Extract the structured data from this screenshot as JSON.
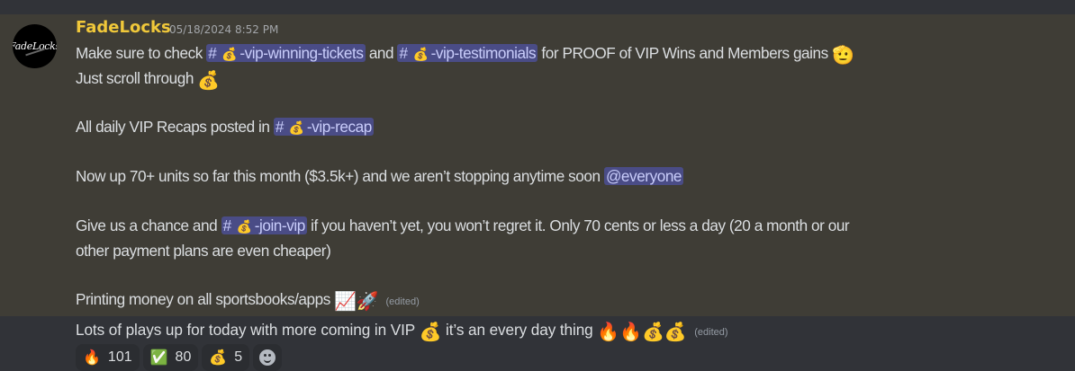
{
  "message": {
    "author": "FadeLocks",
    "avatar_text": "FadeLocks",
    "timestamp": "05/18/2024 8:52 PM",
    "line1_pre": "Make sure to check",
    "channel_winning": "-vip-winning-tickets",
    "line1_and": "and",
    "channel_testimonials": "-vip-testimonials",
    "line1_post": "for PROOF of VIP Wins and Members gains",
    "line2": "Just scroll through",
    "recap_pre": "All daily VIP Recaps posted in",
    "channel_recap": "-vip-recap",
    "units_text": "Now up 70+ units so far this month ($3.5k+) and we aren’t stopping anytime soon",
    "mention_everyone": "@everyone",
    "chance_pre": "Give us a chance and",
    "channel_join": "-join-vip",
    "chance_post": "if you haven’t yet, you won’t regret it. Only 70 cents or less a day (20 a month or our",
    "chance_line2": "other payment plans are even cheaper)",
    "printing": "Printing money on all sportsbooks/apps",
    "edited1": "(edited)",
    "plays_pre": "Lots of plays up for today with more coming in VIP",
    "plays_post": "it’s an every day thing",
    "edited2": "(edited)"
  },
  "icons": {
    "hash": "#",
    "money_bag": "💰",
    "saluting": "🫡",
    "chart": "📈",
    "rocket": "🚀",
    "fire": "🔥"
  },
  "reactions": [
    {
      "emoji": "🔥",
      "count": "101"
    },
    {
      "emoji": "✅",
      "count": "80"
    },
    {
      "emoji": "💰",
      "count": "5"
    }
  ],
  "colors": {
    "highlight_bg": "#3f3d36",
    "author_color": "#f0c83a",
    "mention_bg": "#4a4c86",
    "mention_text": "#c9cdfb"
  }
}
